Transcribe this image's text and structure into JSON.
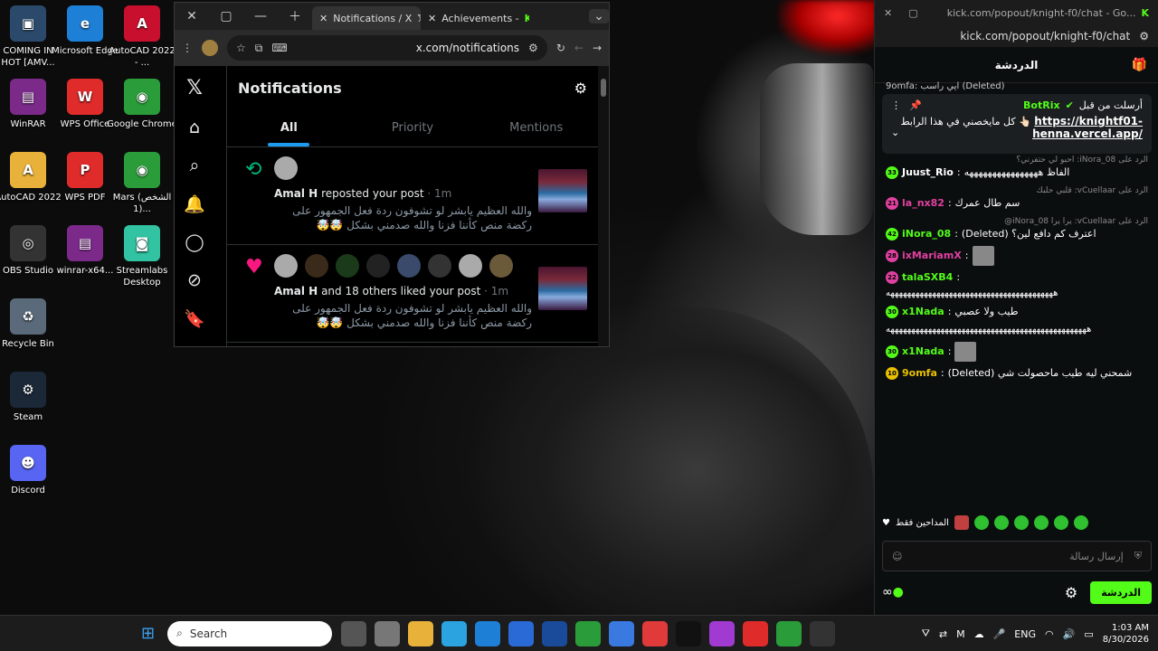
{
  "desktop": {
    "icons": [
      {
        "label": "COMING IN HOT [AMV...",
        "icon": "video-file-icon",
        "color": "#2b4a6b",
        "glyph": "▣"
      },
      {
        "label": "Microsoft Edge",
        "icon": "edge-icon",
        "color": "#1d7fd6",
        "glyph": "e"
      },
      {
        "label": "AutoCAD 2022 - ...",
        "icon": "autocad-icon",
        "color": "#c8102e",
        "glyph": "A"
      },
      {
        "label": "WinRAR",
        "icon": "winrar-icon",
        "color": "#7b2a8a",
        "glyph": "▤"
      },
      {
        "label": "WPS Office",
        "icon": "wps-office-icon",
        "color": "#e02b2b",
        "glyph": "W"
      },
      {
        "label": "Google Chrome",
        "icon": "chrome-icon",
        "color": "#2a9d3a",
        "glyph": "◉"
      },
      {
        "label": "AutoCAD 2022",
        "icon": "autocad-folder-icon",
        "color": "#e8b23a",
        "glyph": "A"
      },
      {
        "label": "WPS PDF",
        "icon": "wps-pdf-icon",
        "color": "#e02b2b",
        "glyph": "P"
      },
      {
        "label": "Mars (الشخص 1)...",
        "icon": "chrome-shortcut-icon",
        "color": "#2a9d3a",
        "glyph": "◉"
      },
      {
        "label": "OBS Studio",
        "icon": "obs-icon",
        "color": "#333333",
        "glyph": "◎"
      },
      {
        "label": "winrar-x64...",
        "icon": "winrar-installer-icon",
        "color": "#7b2a8a",
        "glyph": "▤"
      },
      {
        "label": "Streamlabs Desktop",
        "icon": "streamlabs-icon",
        "color": "#31c3a2",
        "glyph": "◙"
      },
      {
        "label": "Recycle Bin",
        "icon": "recycle-bin-icon",
        "color": "#5a6a7a",
        "glyph": "♻"
      },
      {
        "label": "Steam",
        "icon": "steam-icon",
        "color": "#1b2838",
        "glyph": "⚙"
      },
      {
        "label": "Discord",
        "icon": "discord-icon",
        "color": "#5865f2",
        "glyph": "☻"
      }
    ]
  },
  "browser": {
    "tabs": [
      {
        "title": "Notifications / X",
        "icon": "x-logo-icon"
      },
      {
        "title": "Achievements -",
        "icon": "kick-logo-icon"
      }
    ],
    "url": "x.com/notifications",
    "x": {
      "page_title": "Notifications",
      "tabs": [
        "All",
        "Priority",
        "Mentions"
      ],
      "notifications": [
        {
          "type": "repost",
          "icon": "repost-icon",
          "actor": "Amal H",
          "action": "reposted your post",
          "time": "· 1m",
          "body": "والله العظيم يابشر لو تشوفون ردة فعل الجمهور على ركضة منص كأننا فزنا والله صدمني بشكل 🤯🤯"
        },
        {
          "type": "like",
          "icon": "heart-icon",
          "actor": "Amal H",
          "action": "and 18 others liked your post",
          "time": "· 1m",
          "body": "والله العظيم يابشر لو تشوفون ردة فعل الجمهور على ركضة منص كأننا فزنا والله صدمني بشكل 🤯🤯"
        }
      ]
    }
  },
  "kick": {
    "window_title": "kick.com/popout/knight-f0/chat - Go...",
    "url": "kick.com/popout/knight-f0/chat",
    "header": "الدردشة",
    "pinned": {
      "user": "BotRix",
      "title": "أرسلت من قبل",
      "link": "https://knightf01-henna.vercel.app/",
      "text": "كل مايخصني في هذا الرابط 👆🏻",
      "top_msg": "9omfa: ايي راسب (Deleted)"
    },
    "messages": [
      {
        "reply": "احبو لي حتفرني؟ :iNora_08 الرد على",
        "badge": "33",
        "badge_color": "#53fc18",
        "user": "Juust_Rio",
        "user_color": "#ffffff",
        "text": "الفاظ ههههههههههههههههه"
      },
      {
        "reply": "قلبي حلبك :vCuellaar الرد على",
        "badge": "21",
        "badge_color": "#e040a0",
        "user": "la_nx82",
        "user_color": "#e040a0",
        "text": "سم طال عمرك"
      },
      {
        "reply": "@iNora_08 يرا يرا :vCuellaar الرد على",
        "badge": "42",
        "badge_color": "#53fc18",
        "user": "iNora_08",
        "user_color": "#53fc18",
        "text": "اعترف كم دافع لين؟ (Deleted)"
      },
      {
        "reply": "",
        "badge": "28",
        "badge_color": "#e040a0",
        "user": "ixMariamX",
        "user_color": "#e040a0",
        "text": ""
      },
      {
        "reply": "",
        "badge": "22",
        "badge_color": "#e040a0",
        "user": "talaSXB4",
        "user_color": "#53fc18",
        "text": "ههههههههههههههههههههههههههههههههههههههههه"
      },
      {
        "reply": "",
        "badge": "30",
        "badge_color": "#53fc18",
        "user": "x1Nada",
        "user_color": "#53fc18",
        "text": "طيب ولا عصبي"
      },
      {
        "reply": "",
        "badge": "",
        "badge_color": "",
        "user": "",
        "user_color": "",
        "text": "ههههههههههههههههههههههههههههههههههههههههههههههههه"
      },
      {
        "reply": "",
        "badge": "30",
        "badge_color": "#53fc18",
        "user": "x1Nada",
        "user_color": "#53fc18",
        "text": ""
      },
      {
        "reply": "",
        "badge": "10",
        "badge_color": "#e8c000",
        "user": "9omfa",
        "user_color": "#e8c000",
        "text": "شمحني ليه طيب ماحصولت شي (Deleted)"
      }
    ],
    "emote_label": "المداحين فقط",
    "input_placeholder": "إرسال رسالة",
    "send_label": "الدردشة"
  },
  "taskbar": {
    "search_placeholder": "Search",
    "apps": [
      {
        "icon": "task-view-icon",
        "color": "#555555"
      },
      {
        "icon": "app-generic-icon",
        "color": "#777777"
      },
      {
        "icon": "file-explorer-icon",
        "color": "#e8b23a"
      },
      {
        "icon": "telegram-icon",
        "color": "#2aa3e0"
      },
      {
        "icon": "edge-icon",
        "color": "#1d7fd6"
      },
      {
        "icon": "ms-store-icon",
        "color": "#2a6ad6"
      },
      {
        "icon": "mail-icon",
        "color": "#1a4a9a"
      },
      {
        "icon": "chrome-icon",
        "color": "#2a9d3a"
      },
      {
        "icon": "copilot-icon",
        "color": "#3a7ae0"
      },
      {
        "icon": "pdf-icon",
        "color": "#e03a3a"
      },
      {
        "icon": "netflix-icon",
        "color": "#111111"
      },
      {
        "icon": "color-wheel-icon",
        "color": "#a03ad0"
      },
      {
        "icon": "wps-icon",
        "color": "#e02b2b"
      },
      {
        "icon": "chrome-active-icon",
        "color": "#2a9d3a"
      },
      {
        "icon": "obs-icon",
        "color": "#333333"
      }
    ],
    "lang": "ENG",
    "time": "1:03 AM",
    "date": "8/30/2026"
  },
  "colors": {
    "x_blue": "#1d9bf0",
    "kick_green": "#53fc18",
    "heart": "#f91880",
    "repost": "#00ba7c"
  }
}
